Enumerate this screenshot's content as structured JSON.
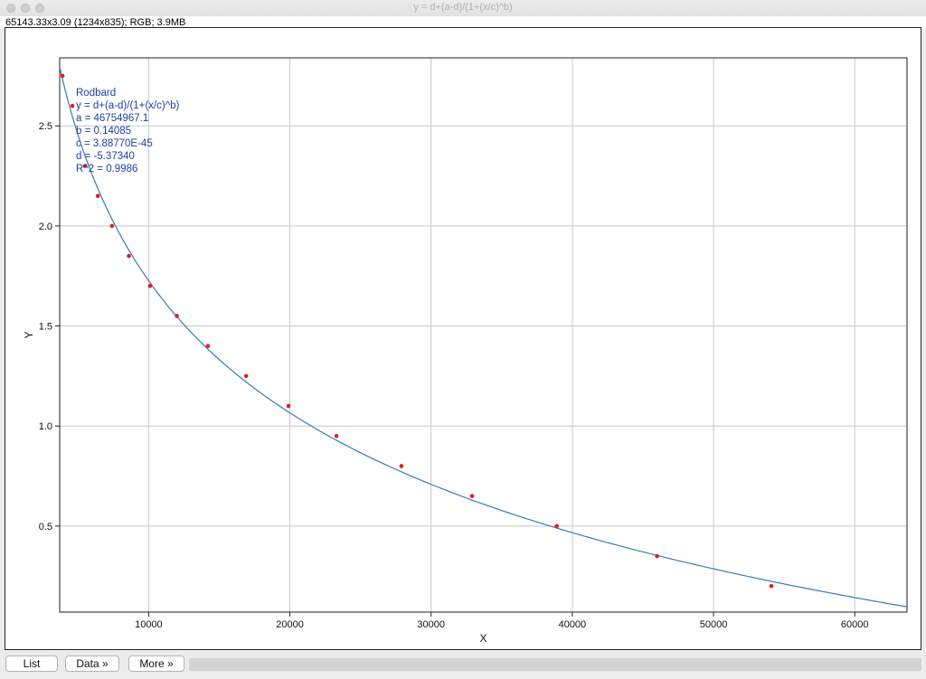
{
  "window": {
    "title": "y = d+(a-d)/(1+(x/c)^b)",
    "info": "65143.33x3.09   (1234x835); RGB; 3.9MB"
  },
  "buttons": {
    "list": "List",
    "data": "Data »",
    "more": "More »"
  },
  "colors": {
    "curve": "#3a78c2",
    "points": "#e0201b",
    "annotation": "#1f3f9e",
    "grid": "#c8c8c8"
  },
  "chart_data": {
    "type": "scatter",
    "xlabel": "X",
    "ylabel": "Y",
    "xlim": [
      3700,
      63700
    ],
    "ylim": [
      0.07,
      2.84
    ],
    "grid": true,
    "xticks": [
      10000,
      20000,
      30000,
      40000,
      50000,
      60000
    ],
    "yticks": [
      0.5,
      1.0,
      1.5,
      2.0,
      2.5
    ],
    "xtick_labels": [
      "10000",
      "20000",
      "30000",
      "40000",
      "50000",
      "60000"
    ],
    "ytick_labels": [
      "0.5",
      "1.0",
      "1.5",
      "2.0",
      "2.5"
    ],
    "points": {
      "x": [
        3900,
        4600,
        5500,
        6400,
        7400,
        8600,
        10100,
        12000,
        14200,
        16900,
        19900,
        23300,
        27900,
        32900,
        38900,
        46000,
        54100
      ],
      "y": [
        2.75,
        2.6,
        2.3,
        2.15,
        2.0,
        1.85,
        1.7,
        1.55,
        1.4,
        1.25,
        1.1,
        0.95,
        0.8,
        0.65,
        0.5,
        0.35,
        0.2
      ]
    },
    "fit": {
      "model": "Rodbard",
      "a": 46754967.1,
      "b": 0.14085,
      "c": 3.8877e-45,
      "d": -5.3734
    },
    "annotation": [
      "Rodbard",
      "y = d+(a-d)/(1+(x/c)^b)",
      "a = 46754967.1",
      "b = 0.14085",
      "c = 3.88770E-45",
      "d = -5.37340",
      "R^2 = 0.9986"
    ]
  }
}
